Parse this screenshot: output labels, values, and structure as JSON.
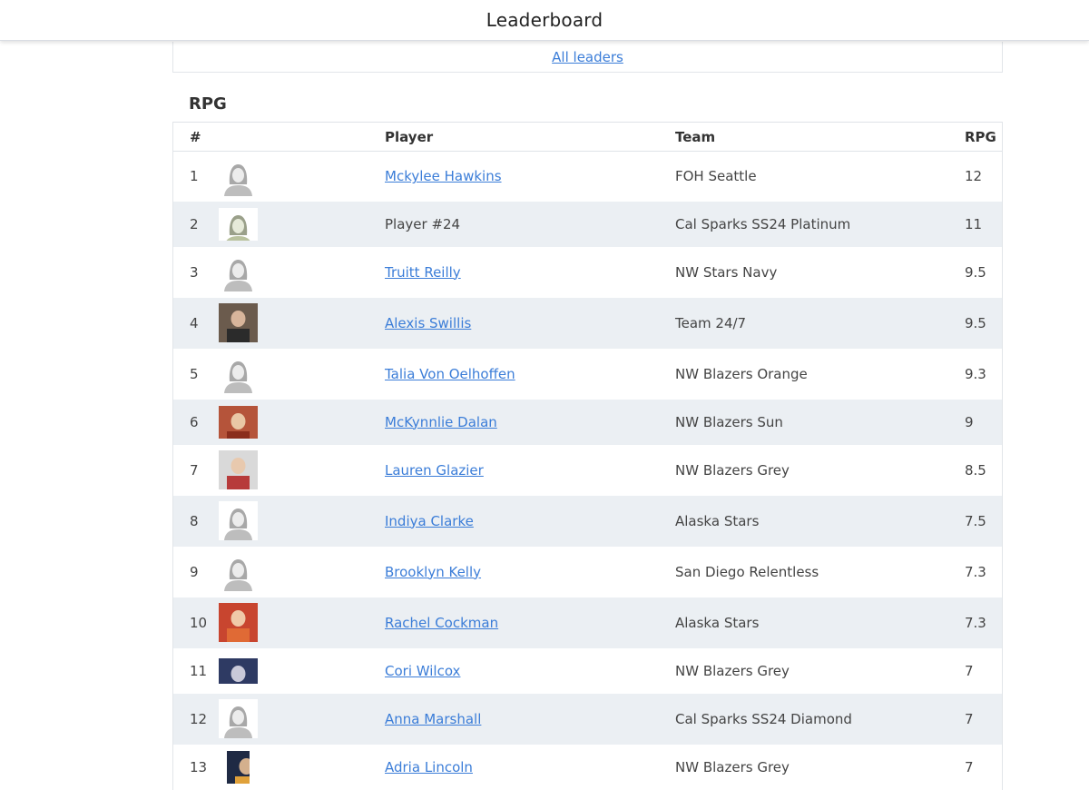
{
  "header": {
    "title": "Leaderboard"
  },
  "nav": {
    "all_leaders": "All leaders"
  },
  "section": {
    "title": "RPG"
  },
  "table": {
    "columns": {
      "rank": "#",
      "player": "Player",
      "team": "Team",
      "stat": "RPG"
    },
    "rows": [
      {
        "rank": "1",
        "player": "Mckylee Hawkins",
        "linked": true,
        "team": "FOH Seattle",
        "stat": "12",
        "photo": "placeholder-avatar"
      },
      {
        "rank": "2",
        "player": "Player #24",
        "linked": false,
        "team": "Cal Sparks SS24 Platinum",
        "stat": "11",
        "photo": "placeholder-avatar-tinted"
      },
      {
        "rank": "3",
        "player": "Truitt Reilly",
        "linked": true,
        "team": "NW Stars Navy",
        "stat": "9.5",
        "photo": "placeholder-avatar"
      },
      {
        "rank": "4",
        "player": "Alexis Swillis",
        "linked": true,
        "team": "Team 24/7",
        "stat": "9.5",
        "photo": "player-photo"
      },
      {
        "rank": "5",
        "player": "Talia Von Oelhoffen",
        "linked": true,
        "team": "NW Blazers Orange",
        "stat": "9.3",
        "photo": "placeholder-avatar"
      },
      {
        "rank": "6",
        "player": "McKynnlie Dalan",
        "linked": true,
        "team": "NW Blazers Sun",
        "stat": "9",
        "photo": "player-photo"
      },
      {
        "rank": "7",
        "player": "Lauren Glazier",
        "linked": true,
        "team": "NW Blazers Grey",
        "stat": "8.5",
        "photo": "player-photo"
      },
      {
        "rank": "8",
        "player": "Indiya Clarke",
        "linked": true,
        "team": "Alaska Stars",
        "stat": "7.5",
        "photo": "placeholder-avatar"
      },
      {
        "rank": "9",
        "player": "Brooklyn Kelly",
        "linked": true,
        "team": "San Diego Relentless",
        "stat": "7.3",
        "photo": "placeholder-avatar"
      },
      {
        "rank": "10",
        "player": "Rachel Cockman",
        "linked": true,
        "team": "Alaska Stars",
        "stat": "7.3",
        "photo": "player-photo"
      },
      {
        "rank": "11",
        "player": "Cori Wilcox",
        "linked": true,
        "team": "NW Blazers Grey",
        "stat": "7",
        "photo": "player-photo"
      },
      {
        "rank": "12",
        "player": "Anna Marshall",
        "linked": true,
        "team": "Cal Sparks SS24 Diamond",
        "stat": "7",
        "photo": "placeholder-avatar"
      },
      {
        "rank": "13",
        "player": "Adria Lincoln",
        "linked": true,
        "team": "NW Blazers Grey",
        "stat": "7",
        "photo": "player-photo"
      }
    ]
  },
  "colors": {
    "link": "#3b7dd8",
    "stripe": "#ebeff3",
    "border": "#e2e5e9"
  }
}
